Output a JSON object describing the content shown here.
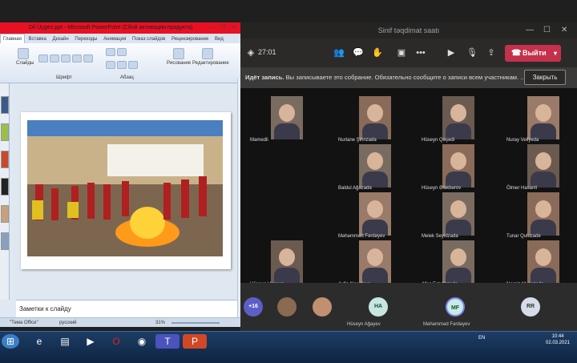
{
  "teams": {
    "title": "Sinif təqdimat saatı",
    "timer": "27:01",
    "leave_label": "Выйти",
    "recording_bold": "Идёт запись.",
    "recording_text": "Вы записываете это собрание. Обязательно сообщите о записи всем участникам. ...",
    "close_label": "Закрыть",
    "participants": [
      {
        "name": "Mamedli",
        "col": 0,
        "row": 0
      },
      {
        "name": "Nurlane Şirinzada",
        "col": 1,
        "row": 0
      },
      {
        "name": "Hüseyn Qəşədi",
        "col": 2,
        "row": 0
      },
      {
        "name": "Nuray Veliyeda",
        "col": 3,
        "row": 0
      },
      {
        "name": "Baldul Ağazada",
        "col": 1,
        "row": 1
      },
      {
        "name": "Hüseyn Ələkbərov",
        "col": 2,
        "row": 1
      },
      {
        "name": "Ölmer Hasanli",
        "col": 3,
        "row": 1
      },
      {
        "name": "Məhəmməd Fərdəyev",
        "col": 1,
        "row": 2
      },
      {
        "name": "Melek Seyidzada",
        "col": 2,
        "row": 2
      },
      {
        "name": "Tunar Quluzade",
        "col": 3,
        "row": 2
      },
      {
        "name": "Hüseyn Huseyn",
        "col": 0,
        "row": 3
      },
      {
        "name": "Ayfin Nacafova",
        "col": 1,
        "row": 3
      },
      {
        "name": "Afaq Fətullazada",
        "col": 2,
        "row": 3
      },
      {
        "name": "Nargiz Musazade",
        "col": 3,
        "row": 3
      }
    ],
    "strip": {
      "count_badge": "+16",
      "people": [
        {
          "initials": "HA",
          "name": "Hüseyn Ağayev",
          "color": "#c7e6e0"
        },
        {
          "initials": "MF",
          "name": "Məhəmməd Fərdəyev",
          "color": "#c8ebe2"
        },
        {
          "initials": "RR",
          "name": "",
          "color": "#d6dde8"
        }
      ]
    }
  },
  "ppt": {
    "title": "Dil Üçgen.ppt - Microsoft PowerPoint (Сбой активации продукта)",
    "tabs": [
      "Главная",
      "Вставка",
      "Дизайн",
      "Переходы",
      "Анимация",
      "Показ слайдов",
      "Рецензирование",
      "Вид"
    ],
    "ribbon": {
      "slides_label": "Слайды",
      "font_label": "Шрифт",
      "paragraph_label": "Абзац",
      "drawing_label": "Рисование",
      "editing_label": "Редактирование"
    },
    "notes_placeholder": "Заметки к слайду",
    "status": {
      "theme": "\"Тема Office\"",
      "language": "русский",
      "zoom": "31%"
    }
  },
  "taskbar": {
    "language": "EN",
    "time": "10:44",
    "date": "02.03.2021"
  },
  "colors": {
    "leave_red": "#c4314b",
    "ppt_title_red": "#e81123",
    "teams_bg": "#1f1f1f"
  }
}
